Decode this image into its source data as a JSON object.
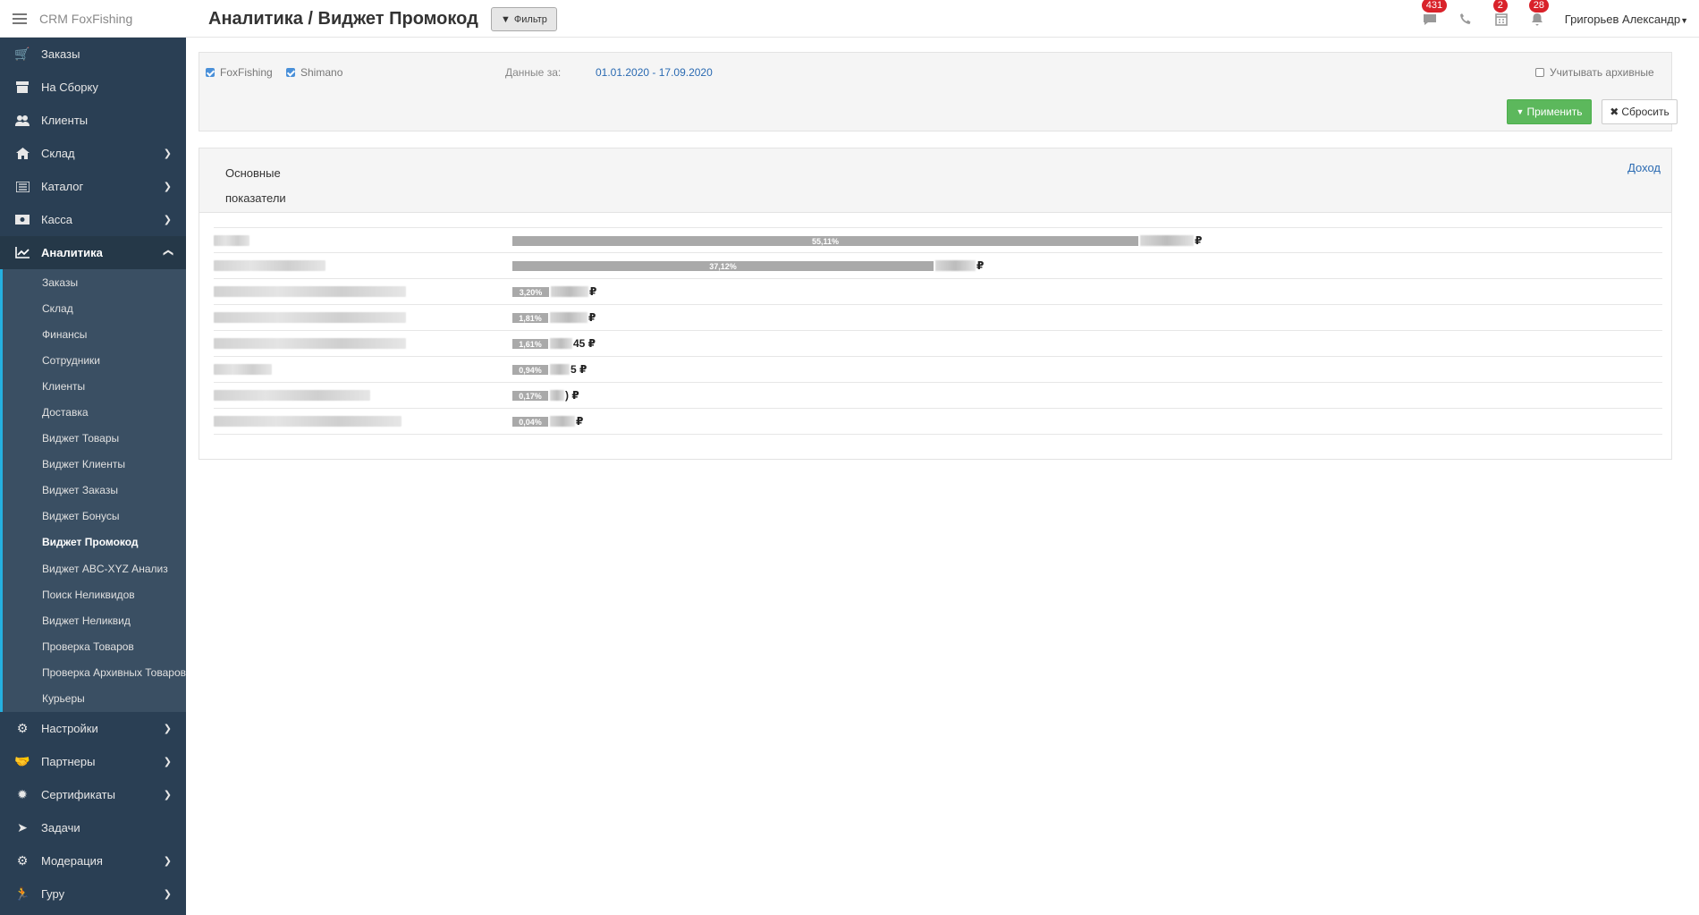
{
  "app": {
    "title": "CRM FoxFishing"
  },
  "header": {
    "page_title": "Аналитика / Виджет Промокод",
    "filter_label": "Фильтр",
    "badges": {
      "messages": "431",
      "tasks": "2",
      "notifications": "28"
    },
    "user_name": "Григорьев Александр"
  },
  "sidebar": {
    "items": [
      {
        "label": "Заказы",
        "icon": "cart-icon"
      },
      {
        "label": "На Сборку",
        "icon": "archive-icon"
      },
      {
        "label": "Клиенты",
        "icon": "users-icon"
      },
      {
        "label": "Склад",
        "icon": "home-icon"
      },
      {
        "label": "Каталог",
        "icon": "list-icon"
      },
      {
        "label": "Касса",
        "icon": "money-icon"
      },
      {
        "label": "Аналитика",
        "icon": "chart-line-icon"
      }
    ],
    "analytics_submenu": [
      "Заказы",
      "Склад",
      "Финансы",
      "Сотрудники",
      "Клиенты",
      "Доставка",
      "Виджет Товары",
      "Виджет Клиенты",
      "Виджет Заказы",
      "Виджет Бонусы",
      "Виджет Промокод",
      "Виджет ABC-XYZ Анализ",
      "Поиск Неликвидов",
      "Виджет Неликвид",
      "Проверка Товаров",
      "Проверка Архивных Товаров",
      "Курьеры"
    ],
    "bottom_items": [
      {
        "label": "Настройки",
        "icon": "gears-icon"
      },
      {
        "label": "Партнеры",
        "icon": "handshake-icon"
      },
      {
        "label": "Сертификаты",
        "icon": "certificate-icon"
      },
      {
        "label": "Задачи",
        "icon": "ticket-icon"
      },
      {
        "label": "Модерация",
        "icon": "gears-icon"
      },
      {
        "label": "Гуру",
        "icon": "walking-icon"
      }
    ]
  },
  "filters": {
    "shop1": "FoxFishing",
    "shop2": "Shimano",
    "date_label": "Данные за:",
    "date_range": "01.01.2020 - 17.09.2020",
    "archive_label": "Учитывать архивные",
    "apply_label": "Применить",
    "reset_label": "Сбросить"
  },
  "panel": {
    "title": "Основные показатели",
    "link": "Доход"
  },
  "chart_data": {
    "type": "bar",
    "currency": "₽",
    "values_percent": [
      55.11,
      37.12,
      3.2,
      1.81,
      1.61,
      0.94,
      0.17,
      0.04
    ],
    "labels": [
      "55,11%",
      "37,12%",
      "3,20%",
      "1,81%",
      "1,61%",
      "0,94%",
      "0,17%",
      "0,04%"
    ],
    "amount_suffixes": [
      "₽",
      "₽",
      "₽",
      "₽",
      "45 ₽",
      "5 ₽",
      ") ₽",
      "₽"
    ]
  }
}
